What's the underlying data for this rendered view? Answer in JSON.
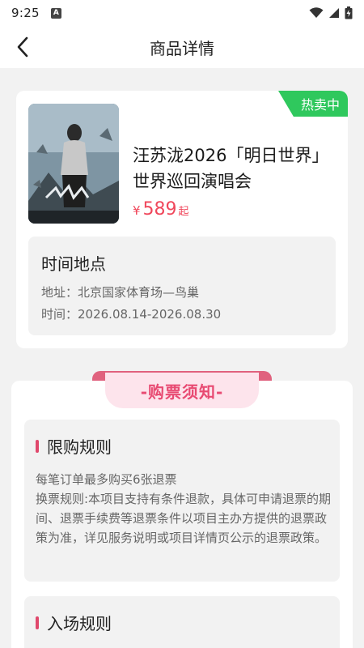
{
  "status_bar": {
    "time": "9:25",
    "notification_letter": "A"
  },
  "nav": {
    "title": "商品详情"
  },
  "product": {
    "badge": "热卖中",
    "name_line1": "汪苏泷2026「明日世界」",
    "name_line2": "世界巡回演唱会",
    "price_currency": "¥",
    "price_value": "589",
    "price_suffix": "起"
  },
  "venue": {
    "title": "时间地点",
    "address": "地址：北京国家体育场—鸟巢",
    "time": "时间：2026.08.14-2026.08.30"
  },
  "notice": {
    "heading": "-购票须知-",
    "rules": [
      {
        "title": "限购规则",
        "line1": "每笔订单最多购买6张退票",
        "line2": "换票规则:本项目支持有条件退款，具体可申请退票的期间、退票手续费等退票条件以项目主办方提供的退票政策为准，详见服务说明或项目详情页公示的退票政策。"
      },
      {
        "title": "入场规则"
      }
    ]
  },
  "colors": {
    "badge_green": "#2fc85d",
    "price_red": "#f0475b",
    "accent_pink": "#e84a72"
  }
}
